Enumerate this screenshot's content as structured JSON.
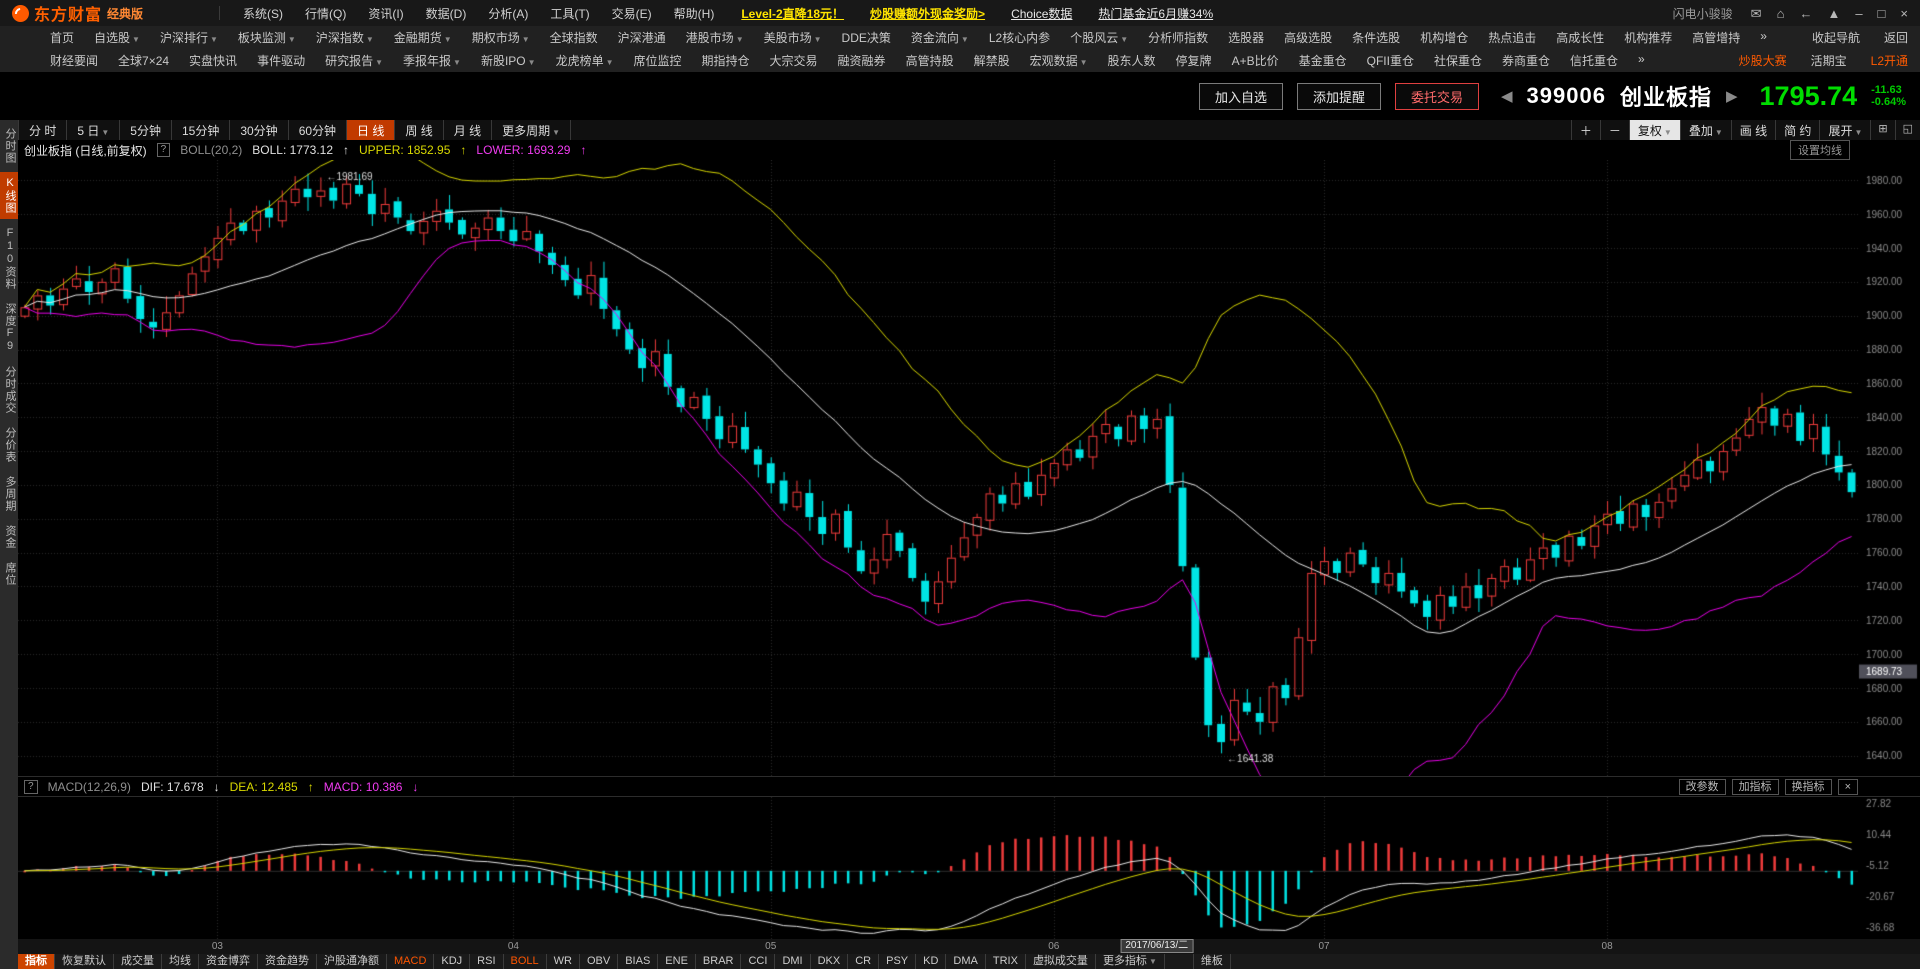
{
  "titlebar": {
    "logo_text": "东方财富",
    "logo_edition": "经典版",
    "menus": [
      "系统(S)",
      "行情(Q)",
      "资讯(I)",
      "数据(D)",
      "分析(A)",
      "工具(T)",
      "交易(E)",
      "帮助(H)"
    ],
    "promos": [
      {
        "label": "Level-2直降18元！",
        "style": "yellow"
      },
      {
        "label": "炒股赚额外现金奖励>",
        "style": "yellow"
      },
      {
        "label": "Choice数据",
        "style": "white"
      },
      {
        "label": "热门基金近6月赚34%",
        "style": "white"
      }
    ],
    "username": "闪电小骏骏",
    "window_icons": [
      "mail",
      "home",
      "back",
      "skin",
      "minimize",
      "restore",
      "close"
    ]
  },
  "nav": {
    "row1": [
      {
        "label": "首页"
      },
      {
        "label": "自选股",
        "dropdown": true
      },
      {
        "label": "沪深排行",
        "dropdown": true
      },
      {
        "label": "板块监测",
        "dropdown": true
      },
      {
        "label": "沪深指数",
        "dropdown": true
      },
      {
        "label": "金融期货",
        "dropdown": true
      },
      {
        "label": "期权市场",
        "dropdown": true
      },
      {
        "label": "全球指数"
      },
      {
        "label": "沪深港通"
      },
      {
        "label": "港股市场",
        "dropdown": true
      },
      {
        "label": "美股市场",
        "dropdown": true
      },
      {
        "label": "DDE决策"
      },
      {
        "label": "资金流向",
        "dropdown": true
      },
      {
        "label": "L2核心内参"
      },
      {
        "label": "个股风云",
        "dropdown": true
      },
      {
        "label": "分析师指数"
      },
      {
        "label": "选股器"
      },
      {
        "label": "高级选股"
      },
      {
        "label": "条件选股"
      },
      {
        "label": "机构增仓"
      },
      {
        "label": "热点追击"
      },
      {
        "label": "高成长性"
      },
      {
        "label": "机构推荐"
      },
      {
        "label": "高管增持"
      },
      {
        "label": "»"
      }
    ],
    "row1_right": [
      {
        "label": "收起导航"
      },
      {
        "label": "返回"
      }
    ],
    "row2": [
      {
        "label": "财经要闻"
      },
      {
        "label": "全球7×24"
      },
      {
        "label": "实盘快讯"
      },
      {
        "label": "事件驱动"
      },
      {
        "label": "研究报告",
        "dropdown": true
      },
      {
        "label": "季报年报",
        "dropdown": true
      },
      {
        "label": "新股IPO",
        "dropdown": true
      },
      {
        "label": "龙虎榜单",
        "dropdown": true
      },
      {
        "label": "席位监控"
      },
      {
        "label": "期指持仓"
      },
      {
        "label": "大宗交易"
      },
      {
        "label": "融资融券"
      },
      {
        "label": "高管持股"
      },
      {
        "label": "解禁股"
      },
      {
        "label": "宏观数据",
        "dropdown": true
      },
      {
        "label": "股东人数"
      },
      {
        "label": "停复牌"
      },
      {
        "label": "A+B比价"
      },
      {
        "label": "基金重仓"
      },
      {
        "label": "QFII重仓"
      },
      {
        "label": "社保重仓"
      },
      {
        "label": "券商重仓"
      },
      {
        "label": "信托重仓"
      },
      {
        "label": "»"
      }
    ],
    "row2_right": [
      {
        "label": "炒股大赛",
        "accent": true
      },
      {
        "label": "活期宝"
      },
      {
        "label": "L2开通",
        "accent": true
      }
    ]
  },
  "header": {
    "buttons": [
      {
        "label": "加入自选"
      },
      {
        "label": "添加提醒"
      },
      {
        "label": "委托交易",
        "accent": true
      }
    ],
    "prev_arrow": "◀",
    "next_arrow": "▶",
    "stock_code": "399006",
    "stock_name": "创业板指",
    "price": "1795.74",
    "change": "-11.63",
    "change_pct": "-0.64%"
  },
  "sidebar": {
    "items": [
      {
        "label": "分时图"
      },
      {
        "label": "K线图",
        "active": true
      },
      {
        "label": "F10资料"
      },
      {
        "label": "深度F9"
      },
      {
        "label": "分时成交"
      },
      {
        "label": "分价表"
      },
      {
        "label": "多周期"
      },
      {
        "label": "资金"
      },
      {
        "label": "席位"
      }
    ]
  },
  "period_tabs": {
    "left": [
      {
        "label": "分 时"
      },
      {
        "label": "5 日",
        "dropdown": true
      },
      {
        "label": "5分钟"
      },
      {
        "label": "15分钟"
      },
      {
        "label": "30分钟"
      },
      {
        "label": "60分钟"
      },
      {
        "label": "日 线",
        "active": true
      },
      {
        "label": "周 线"
      },
      {
        "label": "月 线"
      },
      {
        "label": "更多周期",
        "dropdown": true
      }
    ],
    "right": [
      {
        "label": "＋"
      },
      {
        "label": "－"
      },
      {
        "label": "复权",
        "dropdown": true,
        "pressed": true
      },
      {
        "label": "叠加",
        "dropdown": true
      },
      {
        "label": "画 线"
      },
      {
        "label": "简 约"
      },
      {
        "label": "展开",
        "dropdown": true
      }
    ],
    "right_icons": [
      "candle-style",
      "multi-window"
    ]
  },
  "info_row": {
    "title": "创业板指 (日线,前复权)",
    "help": "?",
    "indicator": "BOLL(20,2)",
    "boll_label": "BOLL: 1773.12",
    "boll_arrow": "↑",
    "upper_label": "UPPER: 1852.95",
    "upper_arrow": "↑",
    "lower_label": "LOWER: 1693.29",
    "lower_arrow": "↑",
    "settings_button": "设置均线"
  },
  "macd_row": {
    "help": "?",
    "indicator": "MACD(12,26,9)",
    "dif_label": "DIF: 17.678",
    "dif_arrow": "↓",
    "dea_label": "DEA: 12.485",
    "dea_arrow": "↑",
    "macd_label": "MACD: 10.386",
    "macd_arrow": "↓",
    "buttons": [
      {
        "label": "改参数"
      },
      {
        "label": "加指标"
      },
      {
        "label": "换指标"
      },
      {
        "label": "×"
      }
    ]
  },
  "bottom_tabs": {
    "items": [
      {
        "label": "指标",
        "active": true
      },
      {
        "label": "恢复默认"
      },
      {
        "label": "成交量"
      },
      {
        "label": "均线"
      },
      {
        "label": "资金博弈"
      },
      {
        "label": "资金趋势"
      },
      {
        "label": "沪股通净额"
      },
      {
        "label": "MACD",
        "accent": true
      },
      {
        "label": "KDJ"
      },
      {
        "label": "RSI"
      },
      {
        "label": "BOLL",
        "accent": true
      },
      {
        "label": "WR"
      },
      {
        "label": "OBV"
      },
      {
        "label": "BIAS"
      },
      {
        "label": "ENE"
      },
      {
        "label": "BRAR"
      },
      {
        "label": "CCI"
      },
      {
        "label": "DMI"
      },
      {
        "label": "DKX"
      },
      {
        "label": "CR"
      },
      {
        "label": "PSY"
      },
      {
        "label": "KD"
      },
      {
        "label": "DMA"
      },
      {
        "label": "TRIX"
      },
      {
        "label": "虚拟成交量"
      },
      {
        "label": "更多指标",
        "dropdown": true
      },
      {
        "label": "维板",
        "gap": true
      }
    ]
  },
  "chart_data": {
    "type": "candlestick",
    "symbol": "399006 创业板指",
    "period": "日线,前复权",
    "y_axis": {
      "min": 1628,
      "max": 1992,
      "ticks": [
        1980,
        1960,
        1940,
        1920,
        1900,
        1880,
        1860,
        1840,
        1820,
        1800,
        1780,
        1760,
        1740,
        1720,
        1700,
        1680,
        1660,
        1640
      ]
    },
    "price_tag": 1689.73,
    "x_ticks": [
      {
        "label": "03",
        "index": 15
      },
      {
        "label": "04",
        "index": 38
      },
      {
        "label": "05",
        "index": 58
      },
      {
        "label": "06",
        "index": 80
      },
      {
        "label": "07",
        "index": 101
      },
      {
        "label": "08",
        "index": 123
      }
    ],
    "date_marker": {
      "label": "2017/06/13/二",
      "index": 88
    },
    "annotations": [
      {
        "index": 23,
        "value": 1981.69,
        "text": "←1981.69",
        "pos": "high"
      },
      {
        "index": 93,
        "value": 1641.38,
        "text": "←1641.38",
        "pos": "low"
      }
    ],
    "first_open": 1900,
    "closes": [
      1905,
      1912,
      1906,
      1916,
      1922,
      1914,
      1920,
      1928,
      1910,
      1898,
      1893,
      1902,
      1912,
      1925,
      1935,
      1946,
      1955,
      1950,
      1962,
      1958,
      1968,
      1975,
      1970,
      1974,
      1968,
      1978,
      1972,
      1960,
      1966,
      1958,
      1950,
      1956,
      1962,
      1955,
      1948,
      1952,
      1958,
      1950,
      1944,
      1950,
      1938,
      1930,
      1921,
      1912,
      1924,
      1904,
      1892,
      1880,
      1869,
      1879,
      1858,
      1846,
      1852,
      1839,
      1827,
      1835,
      1821,
      1812,
      1801,
      1789,
      1796,
      1781,
      1771,
      1783,
      1763,
      1749,
      1756,
      1771,
      1761,
      1745,
      1731,
      1743,
      1757,
      1769,
      1781,
      1795,
      1789,
      1801,
      1793,
      1806,
      1813,
      1821,
      1816,
      1829,
      1836,
      1827,
      1841,
      1833,
      1839,
      1800,
      1752,
      1698,
      1658,
      1648,
      1673,
      1666,
      1660,
      1681,
      1674,
      1710,
      1748,
      1755,
      1748,
      1760,
      1753,
      1742,
      1748,
      1737,
      1730,
      1722,
      1735,
      1728,
      1740,
      1733,
      1745,
      1752,
      1744,
      1756,
      1763,
      1757,
      1770,
      1764,
      1776,
      1783,
      1777,
      1789,
      1781,
      1790,
      1798,
      1806,
      1815,
      1808,
      1820,
      1828,
      1839,
      1846,
      1835,
      1842,
      1826,
      1836,
      1818,
      1807.37,
      1795.74
    ],
    "boll": {
      "period": 20,
      "mult": 2
    },
    "macd": {
      "fast": 12,
      "slow": 26,
      "signal": 9,
      "axis_labels": [
        27.82,
        10.44,
        -5.12,
        -20.67,
        -36.68
      ]
    },
    "colors": {
      "up": "#ee3b3b",
      "down": "#00e5e5",
      "boll_mid": "#e8e8e8",
      "boll_up": "#d7d700",
      "boll_low": "#e800e8",
      "grid": "#2a2a2a",
      "axis_text": "#8a8a8a",
      "macd_dif": "#e8e8e8",
      "macd_dea": "#d7d700"
    }
  }
}
